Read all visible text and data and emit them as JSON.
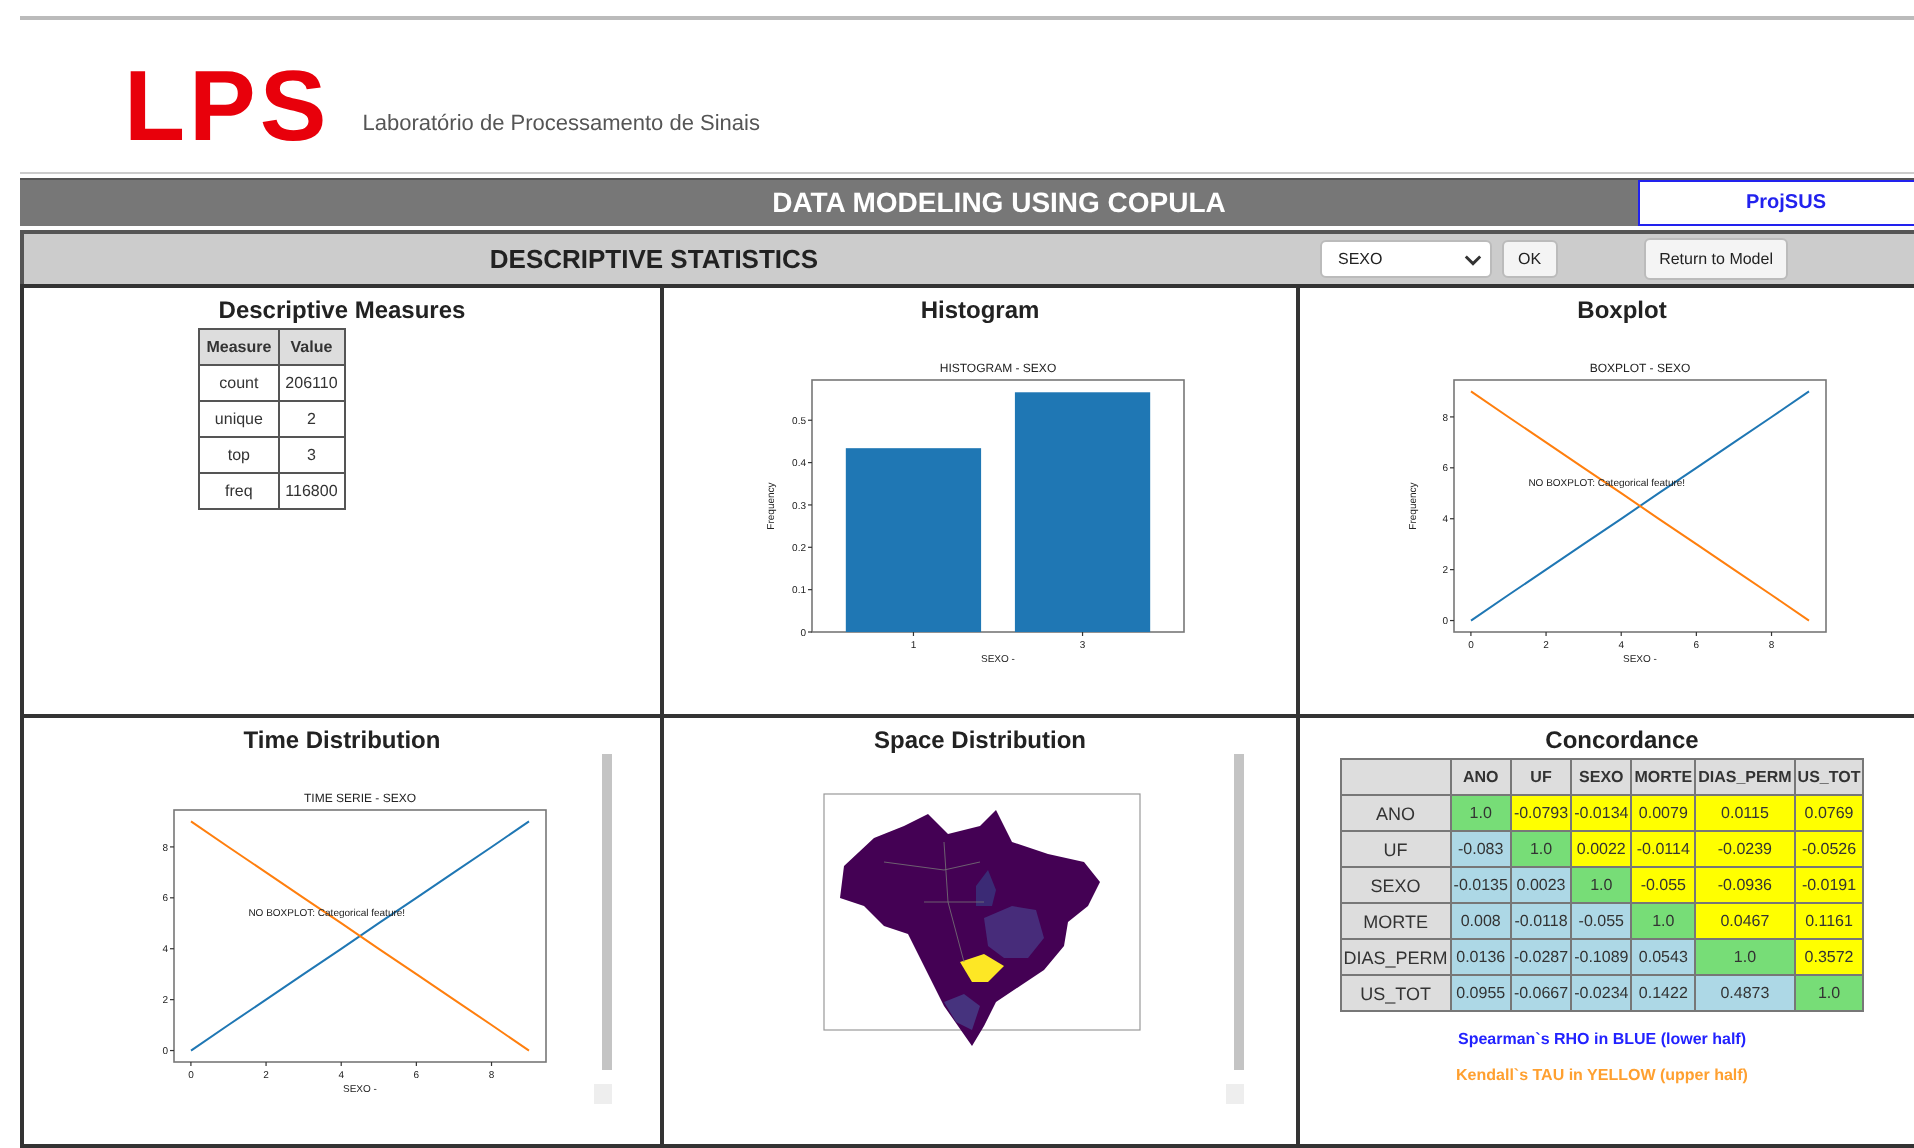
{
  "header": {
    "logo": "LPS",
    "subtitle": "Laboratório de Processamento de Sinais"
  },
  "title_bar": {
    "title": "DATA MODELING USING COPULA",
    "tab": {
      "label": "ProjSUS",
      "selected": true
    }
  },
  "toolbar": {
    "title": "DESCRIPTIVE STATISTICS",
    "feature_select": {
      "value": "SEXO"
    },
    "buttons": [
      "OK",
      "Return to Model"
    ]
  },
  "panels": [
    {
      "kind": "measures",
      "title": "Descriptive Measures",
      "table": {
        "columns": [
          "Measure",
          "Value"
        ],
        "rows": [
          [
            "count",
            "206110"
          ],
          [
            "unique",
            "2"
          ],
          [
            "top",
            "3"
          ],
          [
            "freq",
            "116800"
          ]
        ]
      }
    },
    {
      "kind": "chart",
      "title": "Histogram",
      "chart_data": {
        "type": "bar",
        "title": "HISTOGRAM - SEXO",
        "xlabel": "SEXO -",
        "ylabel": "Frequency",
        "categories": [
          "1",
          "3"
        ],
        "values": [
          0.434,
          0.566
        ],
        "ylim": [
          0,
          0.595
        ],
        "yticks": [
          0,
          0.1,
          0.2,
          0.3,
          0.4,
          0.5
        ]
      }
    },
    {
      "kind": "chart",
      "title": "Boxplot",
      "chart_data": {
        "type": "line",
        "title": "BOXPLOT - SEXO",
        "xlabel": "SEXO -",
        "ylabel": "Frequency",
        "x": [
          0,
          1,
          2,
          3,
          4,
          5,
          6,
          7,
          8,
          9
        ],
        "series": [
          {
            "color": "#1f77b4",
            "values": [
              0,
              1,
              2,
              3,
              4,
              5,
              6,
              7,
              8,
              9
            ]
          },
          {
            "color": "#ff7f0e",
            "values": [
              9,
              8,
              7,
              6,
              5,
              4,
              3,
              2,
              1,
              0
            ]
          }
        ],
        "xlim": [
          -0.45,
          9.45
        ],
        "ylim": [
          -0.45,
          9.45
        ],
        "xticks": [
          0,
          2,
          4,
          6,
          8
        ],
        "yticks": [
          0,
          2,
          4,
          6,
          8
        ],
        "annotations": [
          "NO BOXPLOT: Categorical feature!"
        ]
      }
    },
    {
      "kind": "chart",
      "title": "Time Distribution",
      "scrollable": true,
      "chart_data": {
        "type": "line",
        "title": "TIME SERIE - SEXO",
        "xlabel": "SEXO -",
        "x": [
          0,
          1,
          2,
          3,
          4,
          5,
          6,
          7,
          8,
          9
        ],
        "series": [
          {
            "color": "#1f77b4",
            "values": [
              0,
              1,
              2,
              3,
              4,
              5,
              6,
              7,
              8,
              9
            ]
          },
          {
            "color": "#ff7f0e",
            "values": [
              9,
              8,
              7,
              6,
              5,
              4,
              3,
              2,
              1,
              0
            ]
          }
        ],
        "xlim": [
          -0.45,
          9.45
        ],
        "ylim": [
          -0.45,
          9.45
        ],
        "xticks": [
          0,
          2,
          4,
          6,
          8
        ],
        "yticks": [
          0,
          2,
          4,
          6,
          8
        ],
        "annotations": [
          "NO BOXPLOT: Categorical feature!"
        ]
      }
    },
    {
      "kind": "picture",
      "title": "Space Distribution",
      "scrollable": true
    },
    {
      "kind": "concordance",
      "title": "Concordance",
      "table": {
        "columns": [
          "ANO",
          "UF",
          "SEXO",
          "MORTE",
          "DIAS_PERM",
          "US_TOT"
        ],
        "rows": [
          {
            "label": "ANO",
            "values": [
              "1.0",
              "-0.0793",
              "-0.0134",
              "0.0079",
              "0.0115",
              "0.0769"
            ]
          },
          {
            "label": "UF",
            "values": [
              "-0.083",
              "1.0",
              "0.0022",
              "-0.0114",
              "-0.0239",
              "-0.0526"
            ]
          },
          {
            "label": "SEXO",
            "values": [
              "-0.0135",
              "0.0023",
              "1.0",
              "-0.055",
              "-0.0936",
              "-0.0191"
            ]
          },
          {
            "label": "MORTE",
            "values": [
              "0.008",
              "-0.0118",
              "-0.055",
              "1.0",
              "0.0467",
              "0.1161"
            ]
          },
          {
            "label": "DIAS_PERM",
            "values": [
              "0.0136",
              "-0.0287",
              "-0.1089",
              "0.0543",
              "1.0",
              "0.3572"
            ]
          },
          {
            "label": "US_TOT",
            "values": [
              "0.0955",
              "-0.0667",
              "-0.0234",
              "0.1422",
              "0.4873",
              "1.0"
            ]
          }
        ]
      },
      "legend": [
        {
          "text": "Spearman`s RHO in BLUE (lower half)",
          "color": "#2222ff"
        },
        {
          "text": "Kendall`s TAU in YELLOW (upper half)",
          "color": "#ffa030"
        }
      ]
    }
  ]
}
